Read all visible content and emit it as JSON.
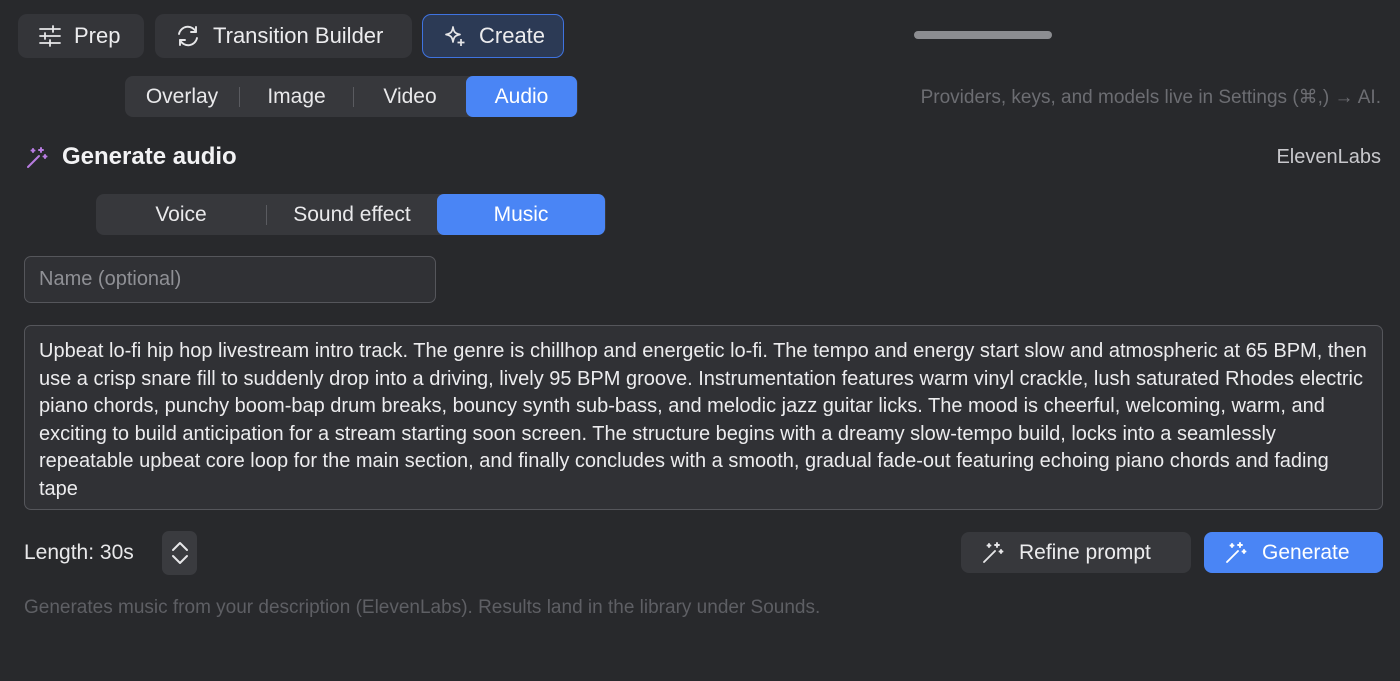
{
  "modes": [
    {
      "label": "Prep",
      "icon": "sliders-icon"
    },
    {
      "label": "Transition Builder",
      "icon": "refresh-icon"
    },
    {
      "label": "Create",
      "icon": "sparkle-icon",
      "active": true
    }
  ],
  "kind_tabs": [
    {
      "label": "Overlay"
    },
    {
      "label": "Image"
    },
    {
      "label": "Video"
    },
    {
      "label": "Audio",
      "active": true
    }
  ],
  "settings_hint": "Providers, keys, and models live in Settings (⌘,) → AI.",
  "section": {
    "title": "Generate audio",
    "icon": "magic-wand-icon",
    "provider": "ElevenLabs"
  },
  "audio_tabs": [
    {
      "label": "Voice"
    },
    {
      "label": "Sound effect"
    },
    {
      "label": "Music",
      "active": true
    }
  ],
  "name_field": {
    "placeholder": "Name (optional)",
    "value": ""
  },
  "prompt": {
    "value": "Upbeat lo-fi hip hop livestream intro track. The genre is chillhop and energetic lo-fi. The tempo and energy start slow and atmospheric at 65 BPM, then use a crisp snare fill to suddenly drop into a driving, lively 95 BPM groove. Instrumentation features warm vinyl crackle, lush saturated Rhodes electric piano chords, punchy boom-bap drum breaks, bouncy synth sub-bass, and melodic jazz guitar licks. The mood is cheerful, welcoming, warm, and exciting to build anticipation for a stream starting soon screen. The structure begins with a dreamy slow-tempo build, locks into a seamlessly repeatable upbeat core loop for the main section, and finally concludes with a smooth, gradual fade-out featuring echoing piano chords and fading tape"
  },
  "length": {
    "label": "Length: 30s"
  },
  "buttons": {
    "refine": "Refine prompt",
    "generate": "Generate"
  },
  "footer_hint": "Generates music from your description (ElevenLabs). Results land in the library under Sounds.",
  "colors": {
    "background": "#28292c",
    "accent": "#4a85f5",
    "wand_icon": "#b77be0"
  }
}
